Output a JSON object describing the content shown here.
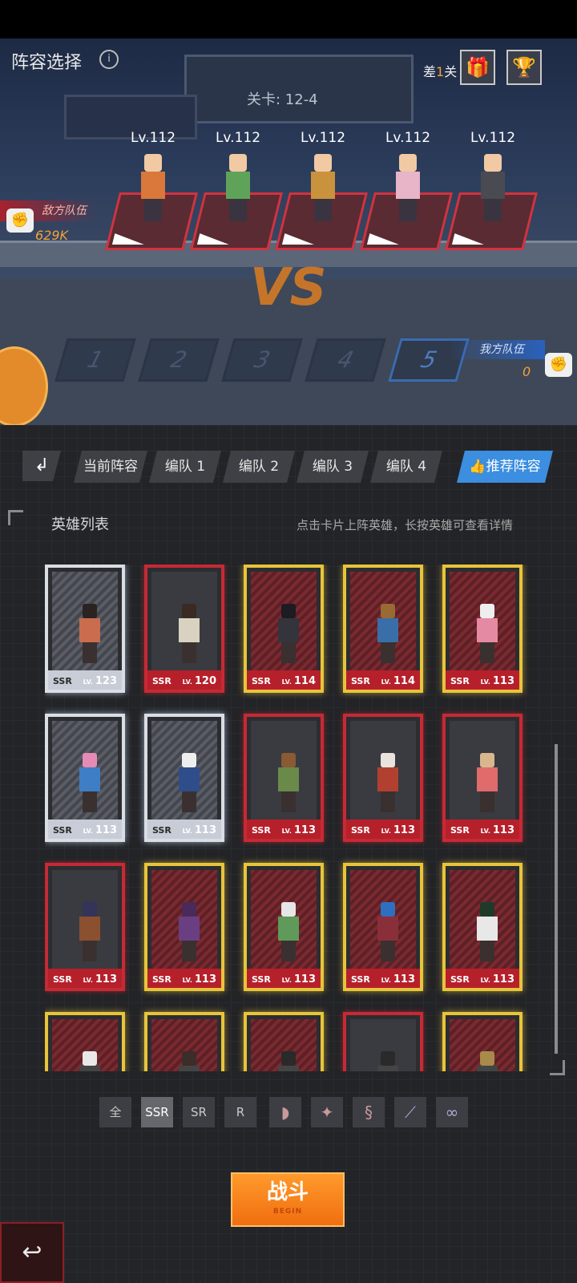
{
  "header": {
    "title": "阵容选择",
    "info_icon": "i",
    "diff_prefix": "差",
    "diff_num": "1",
    "diff_suffix": "关",
    "gift_icon": "gift-icon",
    "trophy_icon": "trophy-icon",
    "stage": "关卡: 12-4"
  },
  "enemy": {
    "label": "敌方队伍",
    "power": "629K",
    "heroes": [
      {
        "level": "Lv.112",
        "color": "#d9783a"
      },
      {
        "level": "Lv.112",
        "color": "#5fa35b"
      },
      {
        "level": "Lv.112",
        "color": "#c9923d"
      },
      {
        "level": "Lv.112",
        "color": "#e7b4c8"
      },
      {
        "level": "Lv.112",
        "color": "#4a4a52"
      }
    ]
  },
  "battlefield": {
    "vs": "VS",
    "slots": [
      "1",
      "2",
      "3",
      "4",
      "5"
    ]
  },
  "my_team": {
    "label": "我方队伍",
    "power": "0"
  },
  "tabs": {
    "current": "当前阵容",
    "team1": "编队 1",
    "team2": "编队 2",
    "team3": "编队 3",
    "team4": "编队 4",
    "recommended": "推荐阵容"
  },
  "hero_list": {
    "title": "英雄列表",
    "hint": "点击卡片上阵英雄，长按英雄可查看详情",
    "cards": [
      {
        "rarity": "SSR",
        "lv": "123",
        "style": "silver",
        "hair": "#2b2320",
        "outfit": "#c96d4e"
      },
      {
        "rarity": "SSR",
        "lv": "120",
        "style": "red",
        "hair": "#3a2a22",
        "outfit": "#d9d2c1"
      },
      {
        "rarity": "SSR",
        "lv": "114",
        "style": "gold",
        "hair": "#1c1c22",
        "outfit": "#34343c"
      },
      {
        "rarity": "SSR",
        "lv": "114",
        "style": "gold",
        "hair": "#9a6a34",
        "outfit": "#3a6ea8"
      },
      {
        "rarity": "SSR",
        "lv": "113",
        "style": "gold",
        "hair": "#eeeeee",
        "outfit": "#e58aa3"
      },
      {
        "rarity": "SSR",
        "lv": "113",
        "style": "silver",
        "hair": "#e68bb5",
        "outfit": "#3e7ec4"
      },
      {
        "rarity": "SSR",
        "lv": "113",
        "style": "silver",
        "hair": "#eeeeee",
        "outfit": "#2f4d8a"
      },
      {
        "rarity": "SSR",
        "lv": "113",
        "style": "red",
        "hair": "#8a5a33",
        "outfit": "#6a8a4a"
      },
      {
        "rarity": "SSR",
        "lv": "113",
        "style": "red",
        "hair": "#e8e3dc",
        "outfit": "#b24030"
      },
      {
        "rarity": "SSR",
        "lv": "113",
        "style": "red",
        "hair": "#d8b78f",
        "outfit": "#e06b6b"
      },
      {
        "rarity": "SSR",
        "lv": "113",
        "style": "red",
        "hair": "#34335a",
        "outfit": "#8a5030"
      },
      {
        "rarity": "SSR",
        "lv": "113",
        "style": "gold",
        "hair": "#4a2a5a",
        "outfit": "#6a3f82"
      },
      {
        "rarity": "SSR",
        "lv": "113",
        "style": "gold",
        "hair": "#e6e6e6",
        "outfit": "#5f9a5a"
      },
      {
        "rarity": "SSR",
        "lv": "113",
        "style": "gold",
        "hair": "#2f6fc0",
        "outfit": "#8a2f3a"
      },
      {
        "rarity": "SSR",
        "lv": "113",
        "style": "gold",
        "hair": "#1f3a2a",
        "outfit": "#e8e8e8"
      },
      {
        "rarity": "",
        "lv": "",
        "style": "gold",
        "hair": "#e8e8e8",
        "outfit": "#444"
      },
      {
        "rarity": "",
        "lv": "",
        "style": "gold",
        "hair": "#3b2d2a",
        "outfit": "#444"
      },
      {
        "rarity": "",
        "lv": "",
        "style": "gold",
        "hair": "#2a2a2a",
        "outfit": "#444"
      },
      {
        "rarity": "",
        "lv": "",
        "style": "red",
        "hair": "#2a2a2a",
        "outfit": "#444"
      },
      {
        "rarity": "",
        "lv": "",
        "style": "gold",
        "hair": "#a88a4a",
        "outfit": "#444"
      }
    ]
  },
  "filters": {
    "all": "全",
    "ssr": "SSR",
    "sr": "SR",
    "r": "R",
    "faction_icons": [
      "faction-1-icon",
      "faction-2-icon",
      "faction-3-icon",
      "faction-4-icon",
      "faction-5-icon"
    ]
  },
  "fight_button": {
    "label": "战斗",
    "sub": "BEGIN"
  },
  "back_icon": "back-icon"
}
